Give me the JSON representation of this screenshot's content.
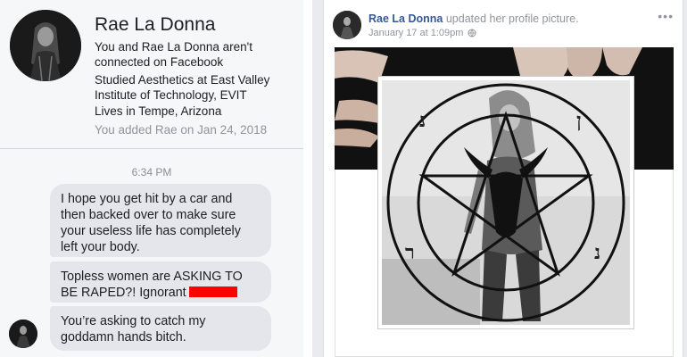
{
  "messenger": {
    "contact_name": "Rae La Donna",
    "connection_note": "You and Rae La Donna aren't connected on Facebook",
    "education": "Studied Aesthetics at East Valley Institute of Technology, EVIT",
    "location": "Lives in Tempe, Arizona",
    "added_note": "You added Rae on Jan 24, 2018",
    "timestamp": "6:34 PM",
    "messages": [
      {
        "text": "I hope you get hit by a car and then backed over to make sure your useless life has completely left your body."
      },
      {
        "text": "Topless women are ASKING TO BE RAPED?! Ignorant"
      },
      {
        "text": "You’re asking to catch my goddamn hands bitch."
      }
    ],
    "redaction_color": "#ff0000"
  },
  "post": {
    "author": "Rae La Donna",
    "action": "updated her profile picture.",
    "time": "January 17 at 1:09pm",
    "privacy_icon": "globe-icon",
    "more_icon": "more-options-icon",
    "link_color": "#365899"
  }
}
